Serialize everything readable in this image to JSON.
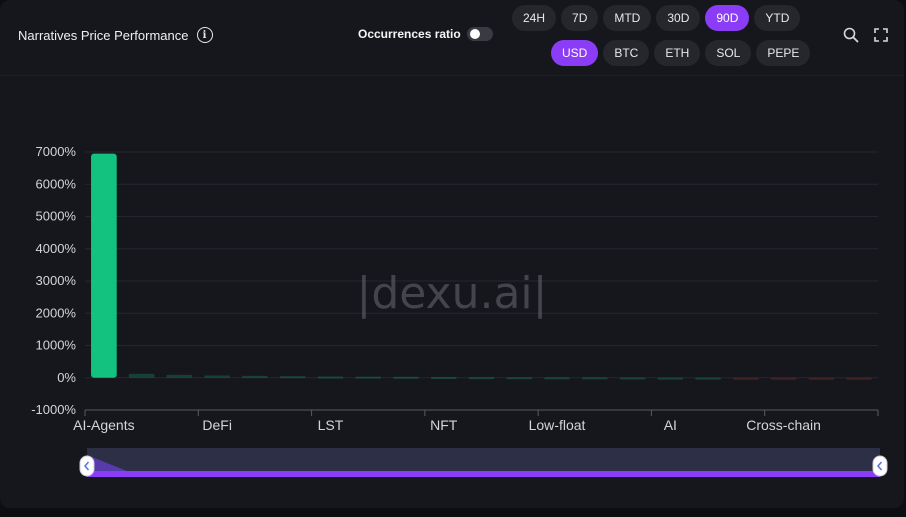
{
  "header": {
    "title": "Narratives Price Performance",
    "occurrences_label": "Occurrences ratio",
    "occurrences_enabled": false,
    "time_ranges": [
      "24H",
      "7D",
      "MTD",
      "30D",
      "90D",
      "YTD"
    ],
    "active_time_range": "90D",
    "currencies": [
      "USD",
      "BTC",
      "ETH",
      "SOL",
      "PEPE"
    ],
    "active_currency": "USD",
    "icons": [
      "search-icon",
      "fullscreen-icon",
      "info-icon"
    ]
  },
  "watermark": "|dexu.ai|",
  "colors": {
    "accent": "#8b3cf7",
    "positive": "#12c27e",
    "negative": "#c0392b"
  },
  "chart_data": {
    "type": "bar",
    "ylim": [
      -1000,
      7000
    ],
    "y_ticks": [
      "7000%",
      "6000%",
      "5000%",
      "4000%",
      "3000%",
      "2000%",
      "1000%",
      "0%",
      "-1000%"
    ],
    "y_tick_values": [
      7000,
      6000,
      5000,
      4000,
      3000,
      2000,
      1000,
      0,
      -1000
    ],
    "x_tick_labels": [
      "AI-Agents",
      "DeFi",
      "LST",
      "NFT",
      "Low-float",
      "AI",
      "Cross-chain"
    ],
    "bar_count": 21,
    "values": [
      6950,
      120,
      90,
      70,
      60,
      50,
      40,
      35,
      30,
      25,
      20,
      15,
      12,
      10,
      8,
      5,
      3,
      -5,
      -10,
      -30,
      -40
    ],
    "grid": true,
    "zoom_range": [
      0,
      100
    ]
  }
}
